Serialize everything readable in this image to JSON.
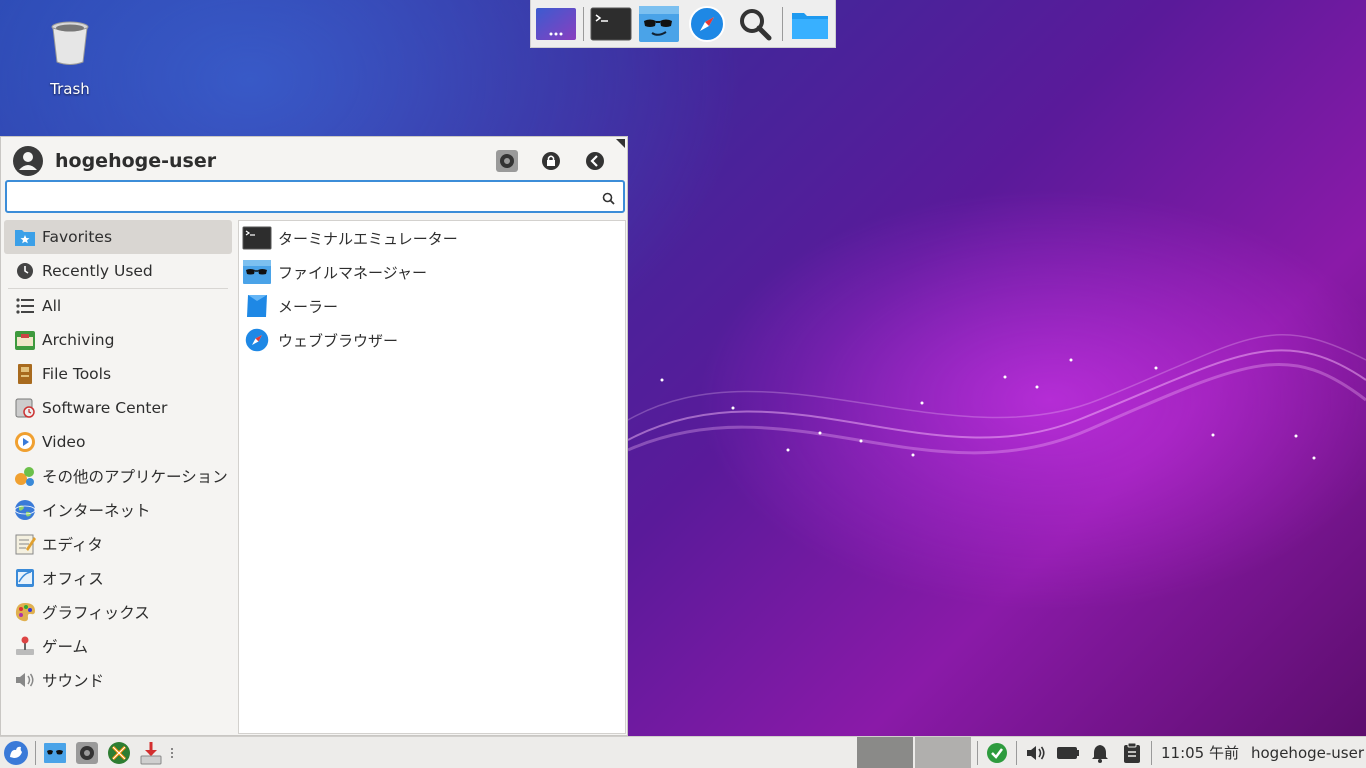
{
  "desktop": {
    "trash_label": "Trash"
  },
  "dock": {
    "items": [
      "workspace-switcher-icon",
      "terminal-icon",
      "file-manager-icon",
      "web-browser-icon",
      "search-icon",
      "folder-icon"
    ]
  },
  "menu": {
    "username": "hogehoge-user",
    "search": {
      "value": "",
      "placeholder": ""
    },
    "categories": [
      {
        "label": "Favorites",
        "icon": "favorites-icon",
        "selected": true
      },
      {
        "label": "Recently Used",
        "icon": "clock-icon"
      },
      {
        "label": "All",
        "icon": "list-icon"
      },
      {
        "label": "Archiving",
        "icon": "archive-icon"
      },
      {
        "label": "File Tools",
        "icon": "file-tools-icon"
      },
      {
        "label": "Software Center",
        "icon": "software-center-icon"
      },
      {
        "label": "Video",
        "icon": "video-icon"
      },
      {
        "label": "その他のアプリケーション",
        "icon": "other-apps-icon"
      },
      {
        "label": "インターネット",
        "icon": "internet-icon"
      },
      {
        "label": "エディタ",
        "icon": "editor-icon"
      },
      {
        "label": "オフィス",
        "icon": "office-icon"
      },
      {
        "label": "グラフィックス",
        "icon": "graphics-icon"
      },
      {
        "label": "ゲーム",
        "icon": "game-icon"
      },
      {
        "label": "サウンド",
        "icon": "sound-icon"
      }
    ],
    "apps": [
      {
        "label": "ターミナルエミュレーター",
        "icon": "terminal-icon"
      },
      {
        "label": "ファイルマネージャー",
        "icon": "file-manager-icon"
      },
      {
        "label": "メーラー",
        "icon": "mail-icon"
      },
      {
        "label": "ウェブブラウザー",
        "icon": "web-browser-icon"
      }
    ]
  },
  "taskbar": {
    "clock": "11:05 午前",
    "user": "hogehoge-user"
  },
  "colors": {
    "accent": "#3c8dd8",
    "selection": "#d9d6d2",
    "panel": "#edecea"
  }
}
